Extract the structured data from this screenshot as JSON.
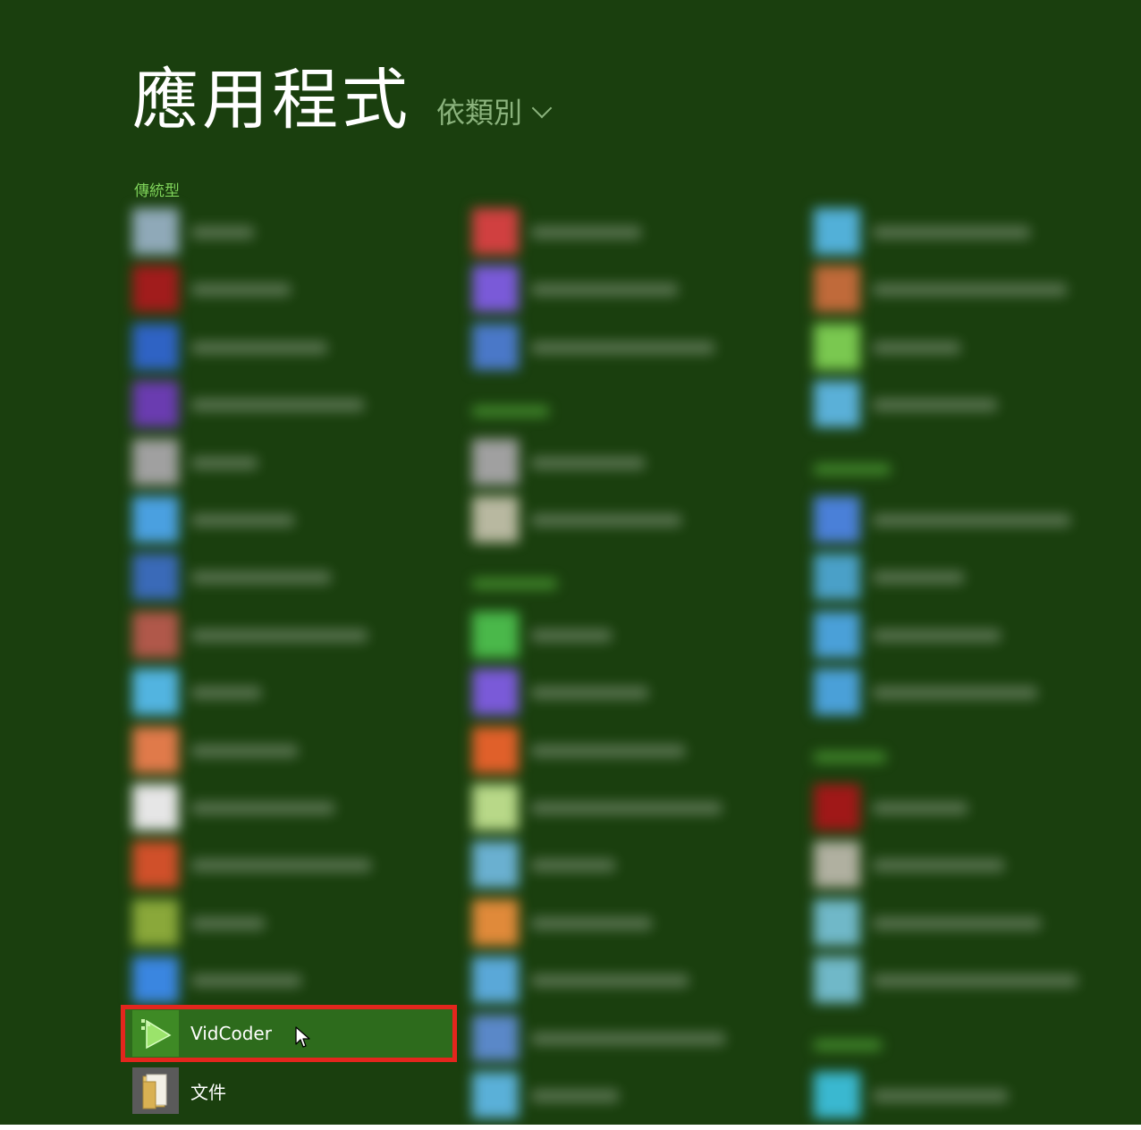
{
  "header": {
    "title": "應用程式",
    "sort_label": "依類別"
  },
  "group": {
    "label": "傳統型"
  },
  "apps": {
    "vidcoder": {
      "label": "VidCoder",
      "icon": "vidcoder-icon"
    },
    "documents": {
      "label": "文件",
      "icon": "folder-documents-icon"
    }
  },
  "colors": {
    "background": "#1a3f0e",
    "highlight": "#2d6b1c",
    "annotation_box": "#e3261d",
    "group_label": "#7fd35a",
    "sort_label": "#8bb37d"
  }
}
